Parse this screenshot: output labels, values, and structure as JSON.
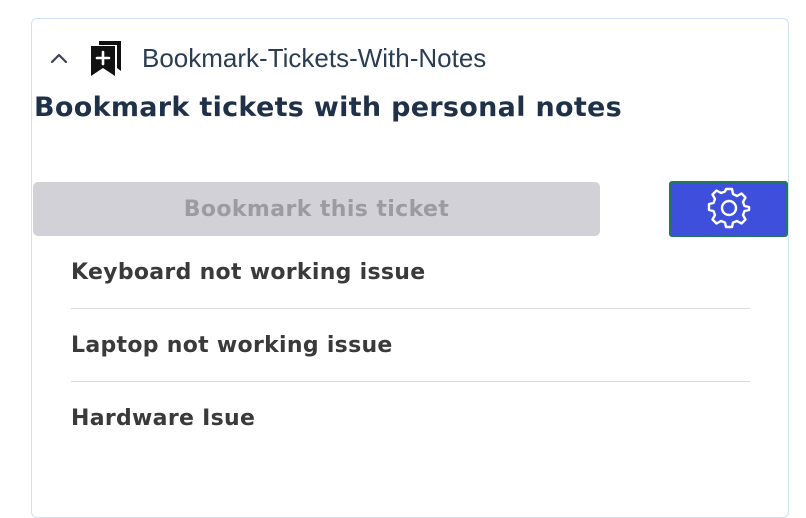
{
  "app": {
    "name": "Bookmark-Tickets-With-Notes",
    "collapse_icon": "chevron-up-icon",
    "logo_icon": "bookmark-add-icon"
  },
  "main": {
    "title": "Bookmark tickets with personal notes",
    "bookmark_button": "Bookmark this ticket",
    "settings_icon": "gear-icon"
  },
  "bookmarks": [
    {
      "label": "Keyboard not working issue"
    },
    {
      "label": "Laptop not working issue"
    },
    {
      "label": "Hardware Isue"
    }
  ],
  "colors": {
    "settings_button_bg": "#3d4fdb",
    "bookmark_button_bg": "#d3d1d8",
    "card_border": "#cfe0f7"
  }
}
